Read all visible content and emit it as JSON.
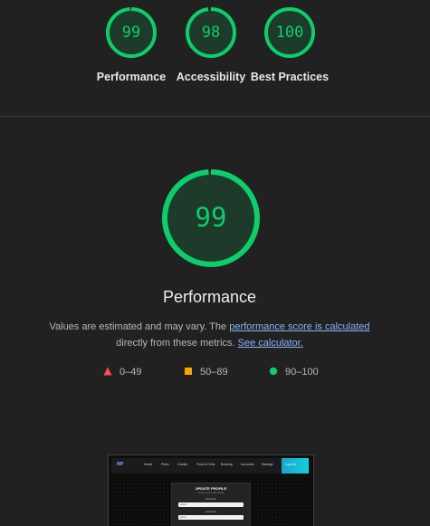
{
  "summary": {
    "gauges": [
      {
        "score": "99",
        "label": "Performance",
        "value": 99
      },
      {
        "score": "98",
        "label": "Accessibility",
        "value": 98
      },
      {
        "score": "100",
        "label": "Best Practices",
        "value": 100
      }
    ]
  },
  "main": {
    "score": "99",
    "value": 99,
    "title": "Performance",
    "desc_before": "Values are estimated and may vary. The ",
    "desc_link": "performance score is calculated",
    "desc_middle": " directly from these metrics. ",
    "desc_link2": "See calculator."
  },
  "legend": [
    {
      "icon": "triangle-icon",
      "range": "0–49",
      "color": "#ff4e42"
    },
    {
      "icon": "square-icon",
      "range": "50–89",
      "color": "#ffa400"
    },
    {
      "icon": "circle-icon",
      "range": "90–100",
      "color": "#0cce6b"
    }
  ],
  "colors": {
    "pass": "#0cce6b",
    "pass_fill": "#1d3a2a",
    "link": "#8ab4f8"
  },
  "thumbnail": {
    "logo": "MP",
    "nav_items": [
      "Home",
      "Plans",
      "Guests",
      "Food & Drink",
      "Booking",
      "Accounts",
      "Manage",
      "Log out"
    ],
    "card_title": "UPDATE PROFILE",
    "card_subtitle": "Update your profile details",
    "field1_label": "First Name",
    "field1_value": "Admin",
    "field2_label": "Last Name",
    "field2_value": "admin"
  }
}
